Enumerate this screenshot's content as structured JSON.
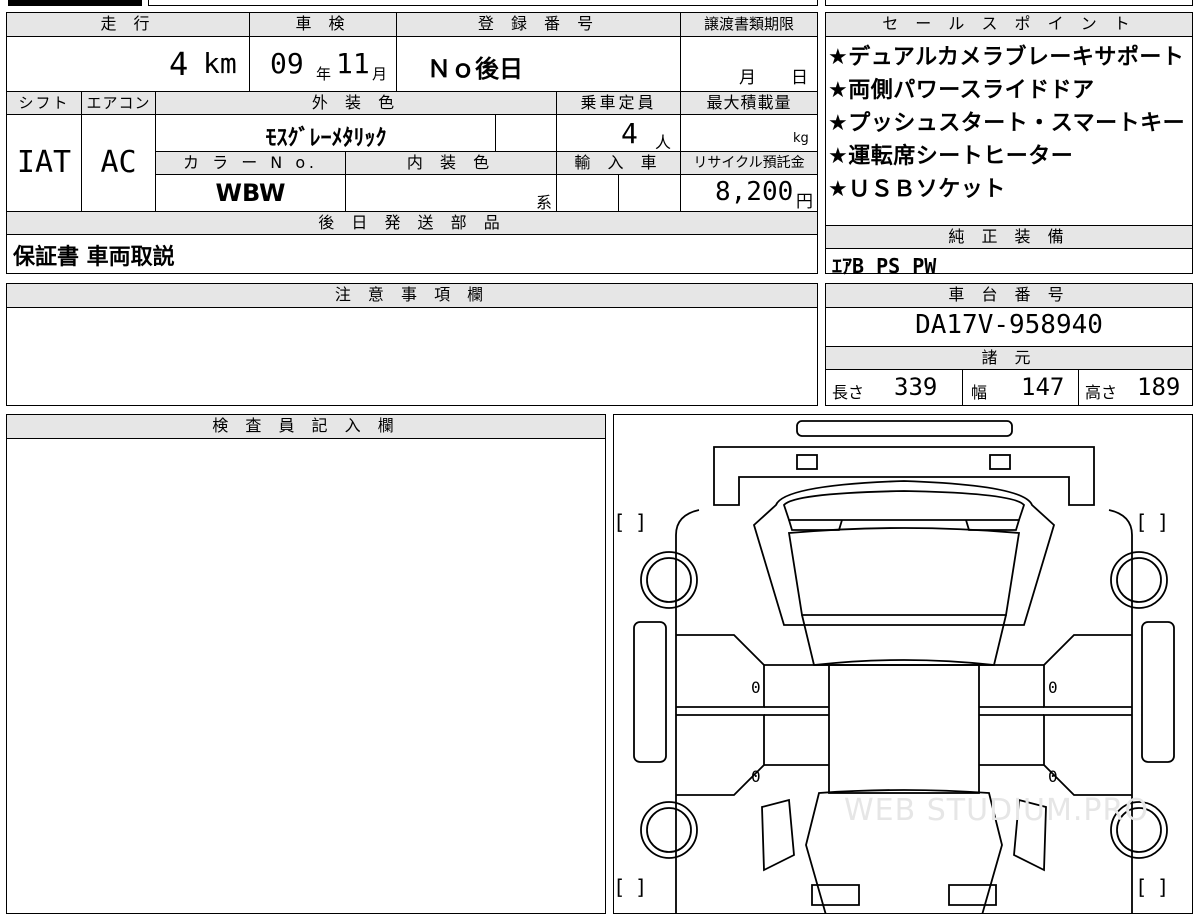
{
  "headers": {
    "mileage": "走 行",
    "inspection": "車 検",
    "registration": "登 録 番 号",
    "transfer_deadline": "譲渡書類期限",
    "shift": "シフト",
    "aircon": "エアコン",
    "exterior_color": "外 装 色",
    "capacity": "乗車定員",
    "max_load": "最大積載量",
    "color_no": "カ ラ ー N o.",
    "interior_color": "内 装 色",
    "imported": "輸 入 車",
    "recycle": "リサイクル預託金",
    "parts_later": "後 日 発 送 部 品",
    "sales_points": "セ ー ル ス ポ イ ン ト",
    "std_equipment": "純 正 装 備",
    "notes": "注 意 事 項 欄",
    "chassis_no": "車 台 番 号",
    "specs": "諸 元",
    "inspector": "検 査 員 記 入 欄"
  },
  "values": {
    "mileage_num": "4",
    "mileage_unit": "km",
    "inspection_year": "09",
    "year_unit": "年",
    "inspection_month": "11",
    "month_unit": "月",
    "registration": "Ｎｏ後日",
    "transfer_month": "月",
    "transfer_day": "日",
    "shift": "IAT",
    "aircon": "AC",
    "exterior_color": "ﾓｽｸﾞﾚｰﾒﾀﾘｯｸ",
    "capacity_num": "4",
    "capacity_unit": "人",
    "load_unit": "kg",
    "color_no": "WBW",
    "interior_suffix": "系",
    "recycle_amount": "8,200",
    "recycle_unit": "円",
    "parts_later": "保証書 車両取説",
    "std_equipment": "ｴｱB PS PW",
    "chassis_no": "DA17V-958940",
    "length_label": "長さ",
    "length": "339",
    "width_label": "幅",
    "width": "147",
    "height_label": "高さ",
    "height": "189"
  },
  "sales_points": [
    "★デュアルカメラブレーキサポート",
    "★両側パワースライドドア",
    "★プッシュスタート・スマートキー",
    "★運転席シートヒーター",
    "★ＵＳＢソケット"
  ],
  "diagram": {
    "bracket": "[  ]",
    "panel_values": [
      "0",
      "0",
      "0",
      "0"
    ],
    "watermark": "WEB STUDIUM.PRO"
  }
}
